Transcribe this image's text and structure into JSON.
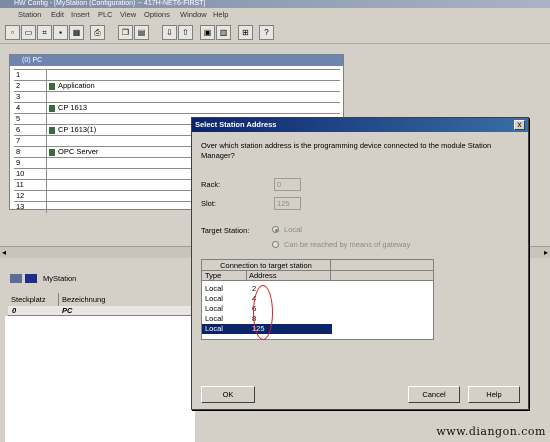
{
  "window": {
    "title": "HW Config - [MyStation (Configuration) -- 417H-NET6-FIRST]"
  },
  "menu": [
    "Station",
    "Edit",
    "Insert",
    "PLC",
    "View",
    "Options",
    "Window",
    "Help"
  ],
  "rack": {
    "title": "(0) PC",
    "rows": [
      {
        "num": "1",
        "module": ""
      },
      {
        "num": "2",
        "module": "Application"
      },
      {
        "num": "3",
        "module": ""
      },
      {
        "num": "4",
        "module": "CP 1613"
      },
      {
        "num": "5",
        "module": ""
      },
      {
        "num": "6",
        "module": "CP 1613(1)"
      },
      {
        "num": "7",
        "module": ""
      },
      {
        "num": "8",
        "module": "OPC Server"
      },
      {
        "num": "9",
        "module": ""
      },
      {
        "num": "10",
        "module": ""
      },
      {
        "num": "11",
        "module": ""
      },
      {
        "num": "12",
        "module": ""
      },
      {
        "num": "13",
        "module": ""
      }
    ]
  },
  "lower": {
    "station": "MyStation",
    "col1": "Steckplatz",
    "col2": "Bezeichnung",
    "sub1": "0",
    "sub2": "PC"
  },
  "dialog": {
    "title": "Select Station Address",
    "question": "Over which station address is the programming device connected to the module Station Manager?",
    "rack_label": "Rack:",
    "rack_value": "0",
    "slot_label": "Slot:",
    "slot_value": "125",
    "target_label": "Target Station:",
    "option_local": "Local",
    "option_gateway": "Can be reached by means of gateway",
    "table": {
      "group_header": "Connection to target station",
      "col_type": "Type",
      "col_address": "Address",
      "rows": [
        {
          "type": "Local",
          "address": "2"
        },
        {
          "type": "Local",
          "address": "4"
        },
        {
          "type": "Local",
          "address": "6"
        },
        {
          "type": "Local",
          "address": "8"
        },
        {
          "type": "Local",
          "address": "125"
        }
      ]
    },
    "ok": "OK",
    "cancel": "Cancel",
    "help": "Help",
    "close": "x"
  },
  "watermark": "www.diangon.com",
  "colors": {
    "dialog_title": "#0a246a",
    "selection": "#0a246a",
    "annotation": "#d62020"
  }
}
